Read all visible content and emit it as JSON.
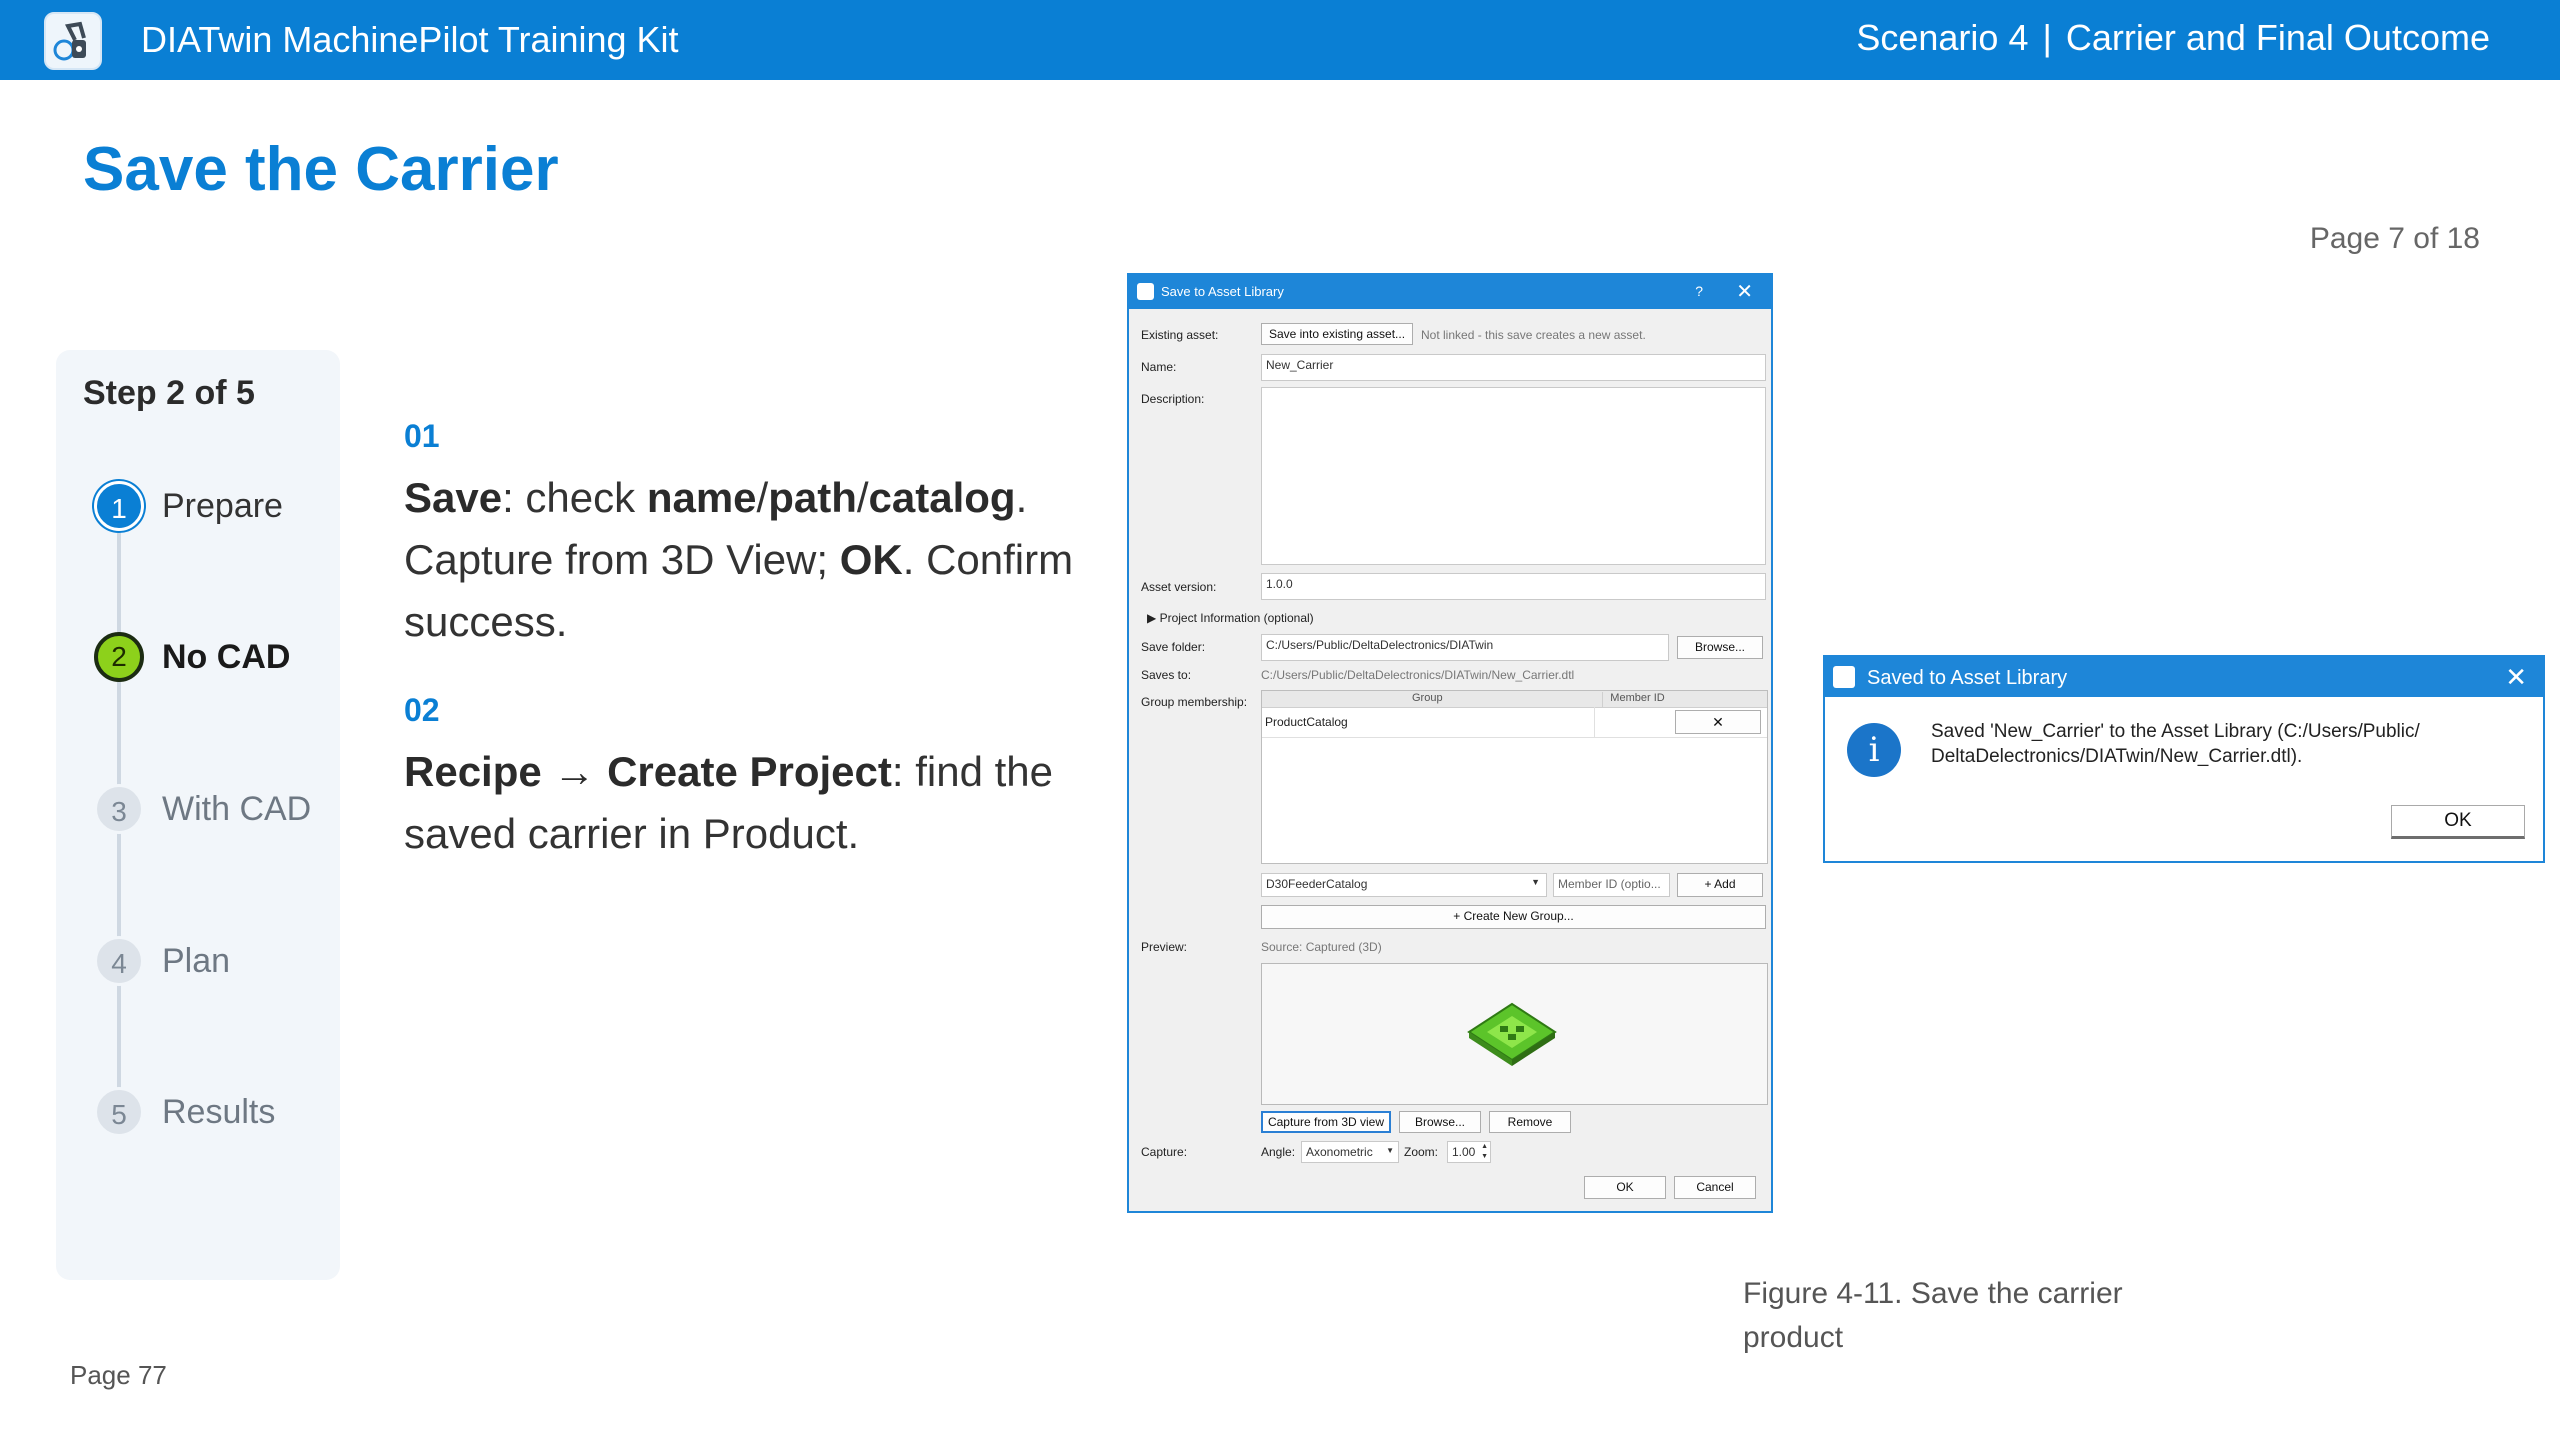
{
  "header": {
    "app_title": "DIATwin MachinePilot Training Kit",
    "scenario": "Scenario 4",
    "separator": "|",
    "section": "Carrier and Final Outcome",
    "logo_icon": "robot-arm-icon",
    "bar_color": "#0a7fd4"
  },
  "page": {
    "heading": "Save the Carrier",
    "page_of": "Page 7 of 18",
    "page_number": "Page 77"
  },
  "stepper": {
    "count": "Step 2 of 5",
    "steps": [
      {
        "num": "1",
        "label": "Prepare",
        "state": "done"
      },
      {
        "num": "2",
        "label": "No CAD",
        "state": "active"
      },
      {
        "num": "3",
        "label": "With CAD",
        "state": "todo"
      },
      {
        "num": "4",
        "label": "Plan",
        "state": "todo"
      },
      {
        "num": "5",
        "label": "Results",
        "state": "todo"
      }
    ]
  },
  "instructions": [
    {
      "num": "01",
      "parts": [
        {
          "t": "Save",
          "b": true
        },
        {
          "t": ": check "
        },
        {
          "t": "name",
          "b": true
        },
        {
          "t": "/"
        },
        {
          "t": "path",
          "b": true
        },
        {
          "t": "/"
        },
        {
          "t": "catalog",
          "b": true
        },
        {
          "t": ". Capture from 3D View; "
        },
        {
          "t": "OK",
          "b": true
        },
        {
          "t": ". Confirm success."
        }
      ]
    },
    {
      "num": "02",
      "parts": [
        {
          "t": "Recipe → Create Project",
          "b": true
        },
        {
          "t": ": find the saved carrier in Product."
        }
      ]
    }
  ],
  "save_dialog": {
    "title": "Save to Asset Library",
    "help": "?",
    "close": "✕",
    "existing_label": "Existing asset:",
    "existing_button": "Save into existing asset...",
    "existing_note": "Not linked - this save creates a new asset.",
    "name_label": "Name:",
    "name_value": "New_Carrier",
    "description_label": "Description:",
    "description_value": "",
    "version_label": "Asset version:",
    "version_value": "1.0.0",
    "project_info": "Project Information (optional)",
    "folder_label": "Save folder:",
    "folder_value": "C:/Users/Public/DeltaDelectronics/DIATwin",
    "browse": "Browse...",
    "saves_to_label": "Saves to:",
    "saves_to_value": "C:/Users/Public/DeltaDelectronics/DIATwin/New_Carrier.dtl",
    "group_label": "Group membership:",
    "group_header": "Group",
    "member_header": "Member ID",
    "group_row": "ProductCatalog",
    "remove_row": "✕",
    "catalog_select": "D30FeederCatalog",
    "member_placeholder": "Member ID (optio...",
    "add": "+ Add",
    "create_group": "+ Create New Group...",
    "preview_label": "Preview:",
    "preview_source": "Source: Captured (3D)",
    "capture_button": "Capture from 3D view",
    "preview_browse": "Browse...",
    "remove": "Remove",
    "capture_label": "Capture:",
    "angle_label": "Angle:",
    "angle_value": "Axonometric",
    "zoom_label": "Zoom:",
    "zoom_value": "1.00",
    "ok": "OK",
    "cancel": "Cancel"
  },
  "saved_dialog": {
    "title": "Saved to Asset Library",
    "close": "✕",
    "icon": "i",
    "message": "Saved 'New_Carrier' to the Asset Library (C:/Users/Public/ DeltaDelectronics/DIATwin/New_Carrier.dtl).",
    "ok": "OK"
  },
  "figure_caption": "Figure 4-11. Save the carrier product"
}
